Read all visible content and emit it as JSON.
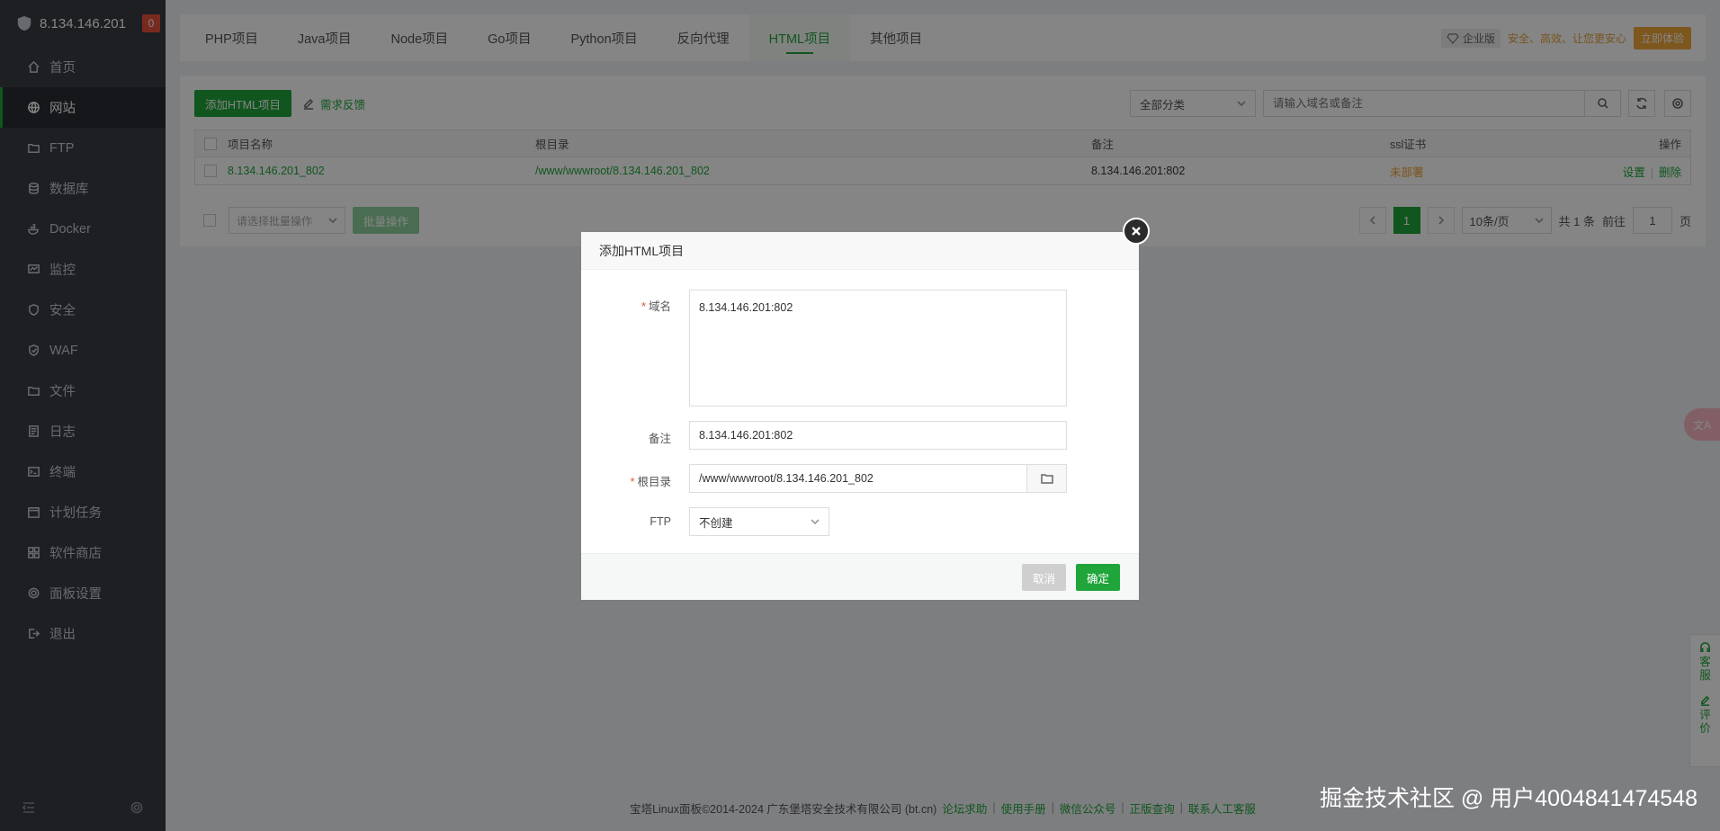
{
  "sidebar": {
    "server_ip": "8.134.146.201",
    "badge": "0",
    "items": [
      {
        "label": "首页"
      },
      {
        "label": "网站"
      },
      {
        "label": "FTP"
      },
      {
        "label": "数据库"
      },
      {
        "label": "Docker"
      },
      {
        "label": "监控"
      },
      {
        "label": "安全"
      },
      {
        "label": "WAF"
      },
      {
        "label": "文件"
      },
      {
        "label": "日志"
      },
      {
        "label": "终端"
      },
      {
        "label": "计划任务"
      },
      {
        "label": "软件商店"
      },
      {
        "label": "面板设置"
      },
      {
        "label": "退出"
      }
    ],
    "active_index": 1
  },
  "tabs": [
    {
      "label": "PHP项目"
    },
    {
      "label": "Java项目"
    },
    {
      "label": "Node项目"
    },
    {
      "label": "Go项目"
    },
    {
      "label": "Python项目"
    },
    {
      "label": "反向代理"
    },
    {
      "label": "HTML项目"
    },
    {
      "label": "其他项目"
    }
  ],
  "active_tab": 6,
  "ad": {
    "enterprise": "企业版",
    "slogan": "安全、高效、让您更安心",
    "try": "立即体验"
  },
  "toolbar": {
    "add_button": "添加HTML项目",
    "feedback": "需求反馈",
    "category_select": "全部分类",
    "search_placeholder": "请输入域名或备注"
  },
  "table": {
    "headers": [
      "项目名称",
      "根目录",
      "备注",
      "ssl证书",
      "操作"
    ],
    "rows": [
      {
        "name": "8.134.146.201_802",
        "root": "/www/wwwroot/8.134.146.201_802",
        "remark": "8.134.146.201:802",
        "ssl": "未部署",
        "action_settings": "设置",
        "action_delete": "删除"
      }
    ]
  },
  "batch": {
    "select_placeholder": "请选择批量操作",
    "button": "批量操作"
  },
  "pager": {
    "current": "1",
    "per_page": "10条/页",
    "total": "共 1 条",
    "goto_label": "前往",
    "goto_value": "1",
    "page_suffix": "页"
  },
  "footer": {
    "copyright": "宝塔Linux面板©2014-2024 广东堡塔安全技术有限公司 (bt.cn)",
    "links": [
      "论坛求助",
      "使用手册",
      "微信公众号",
      "正版查询",
      "联系人工客服"
    ]
  },
  "float": {
    "translate": "文A",
    "service": [
      "客",
      "服"
    ],
    "review": [
      "评",
      "价"
    ]
  },
  "modal": {
    "title": "添加HTML项目",
    "domain_label": "域名",
    "domain_value": "8.134.146.201:802",
    "remark_label": "备注",
    "remark_value": "8.134.146.201:802",
    "root_label": "根目录",
    "root_value": "/www/wwwroot/8.134.146.201_802",
    "ftp_label": "FTP",
    "ftp_value": "不创建",
    "cancel": "取消",
    "confirm": "确定"
  },
  "watermark": "掘金技术社区 @ 用户4004841474548",
  "colors": {
    "accent": "#20a53a",
    "sidebar_bg": "#3a3d44",
    "warning": "#f0a030",
    "danger": "#e5533c"
  }
}
